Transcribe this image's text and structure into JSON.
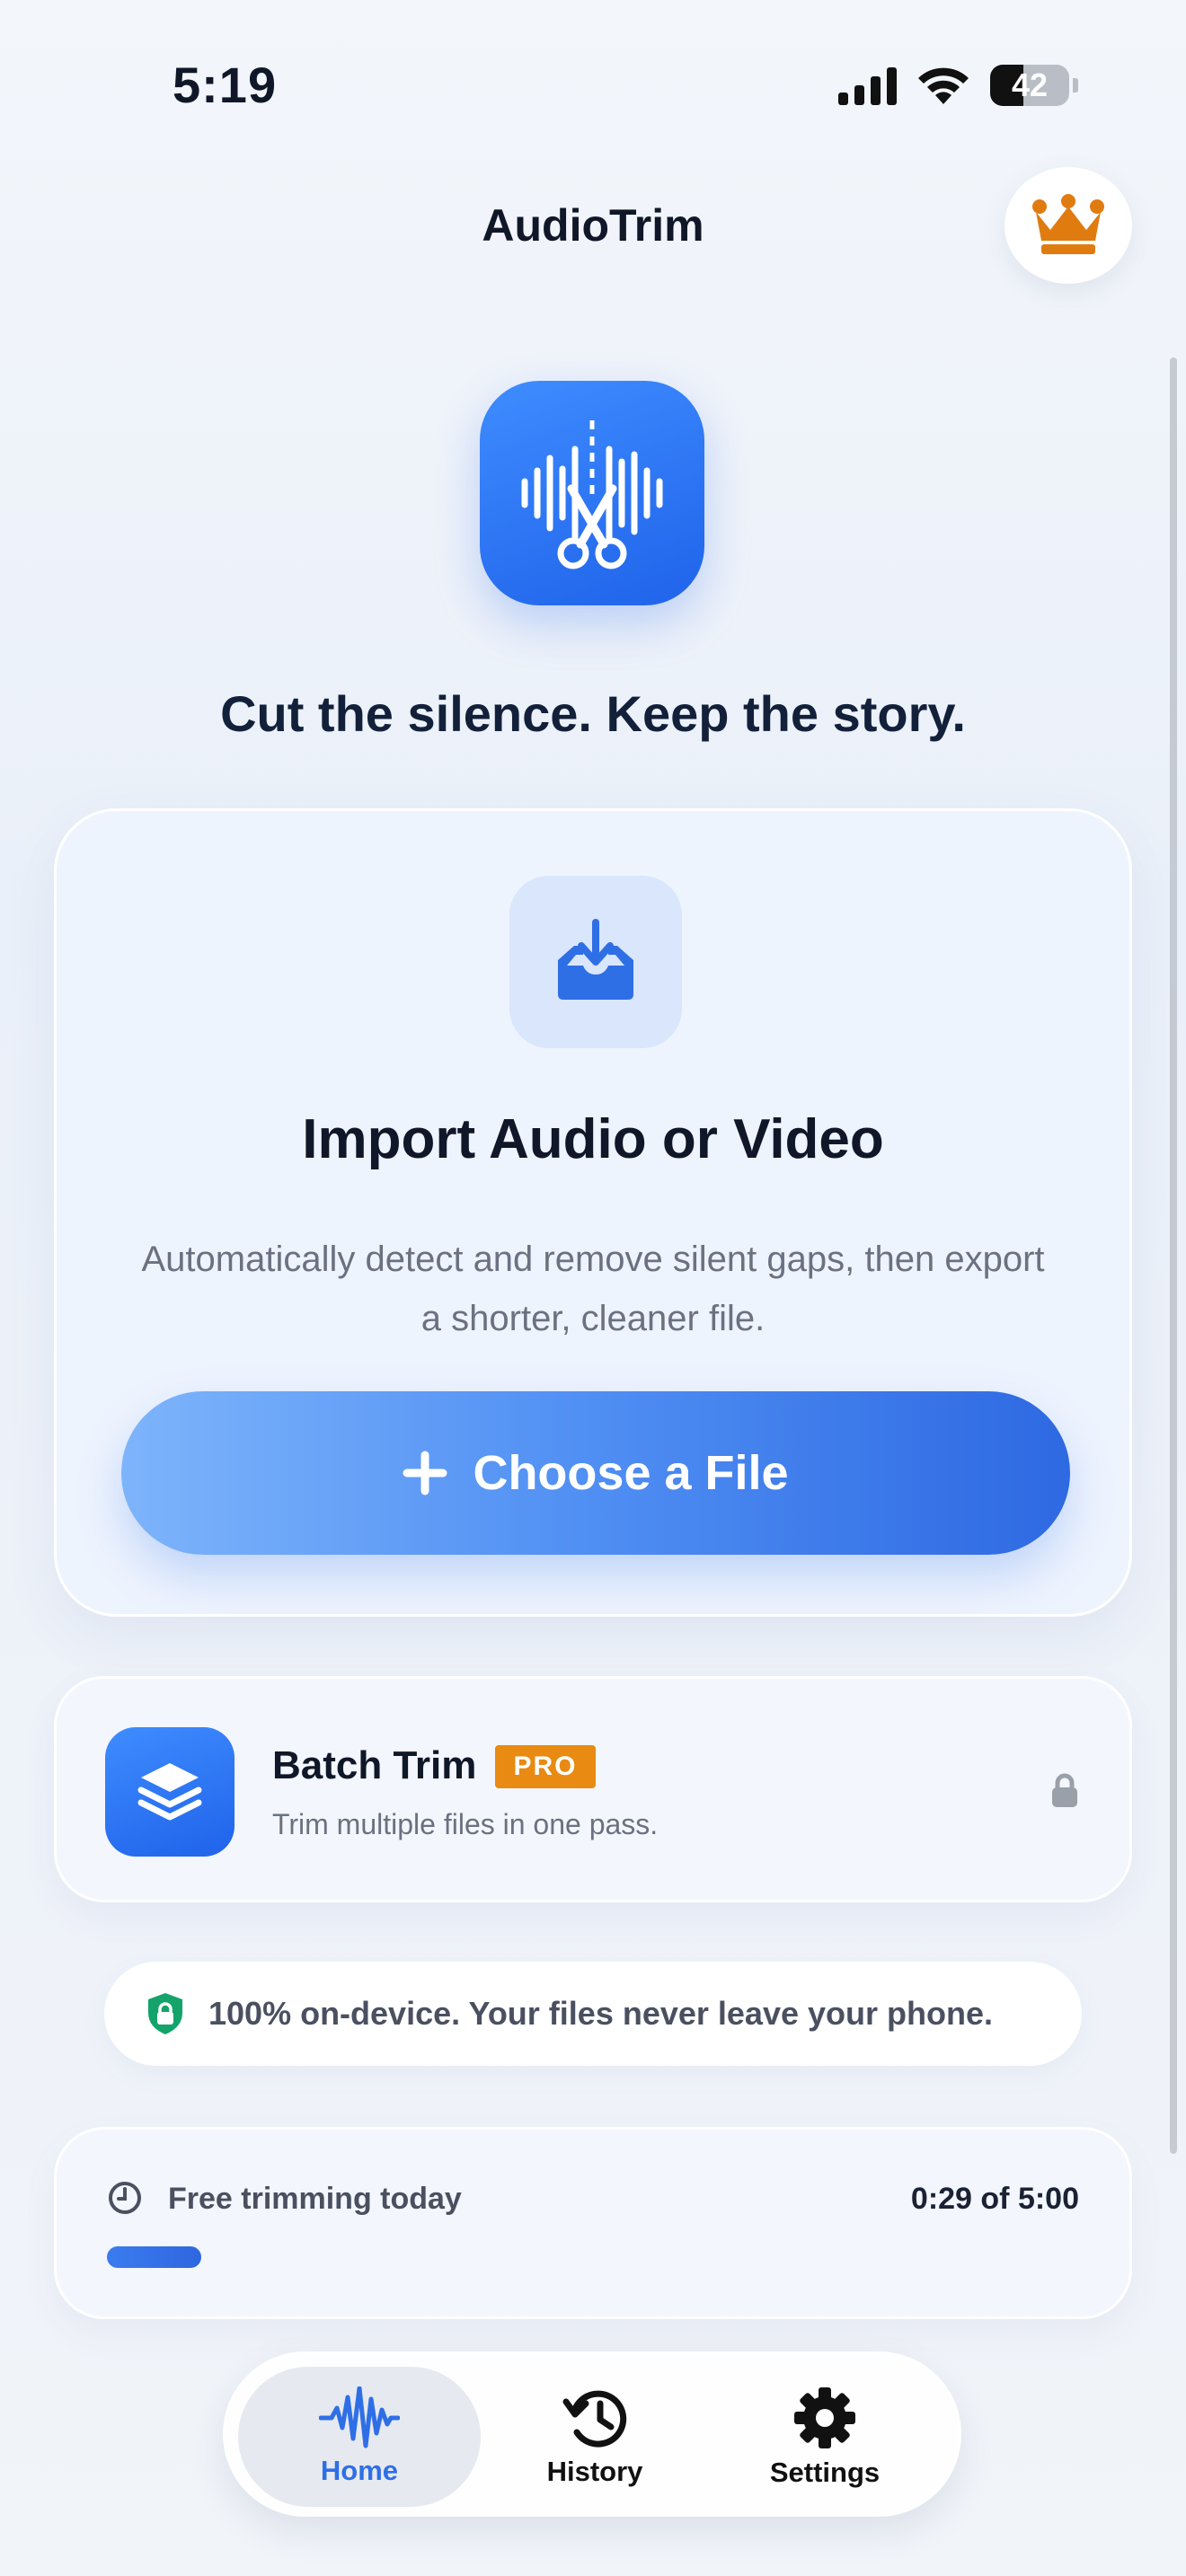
{
  "status_bar": {
    "time": "5:19",
    "battery": "42"
  },
  "header": {
    "title": "AudioTrim",
    "premium_icon": "crown-icon"
  },
  "hero": {
    "app_icon": "waveform-scissors-icon",
    "tagline": "Cut the silence. Keep the story."
  },
  "import_card": {
    "icon": "tray-download-icon",
    "title": "Import Audio or Video",
    "description": "Automatically detect and remove silent gaps, then export a shorter, cleaner file.",
    "button_label": "Choose a File"
  },
  "batch": {
    "icon": "layers-icon",
    "title": "Batch Trim",
    "badge": "PRO",
    "subtitle": "Trim multiple files in one pass."
  },
  "privacy": {
    "icon": "shield-lock-icon",
    "text": "100% on-device. Your files never leave your phone."
  },
  "usage": {
    "label": "Free trimming today",
    "value": "0:29 of 5:00",
    "progress_fraction": 0.097
  },
  "tabs": [
    {
      "label": "Home",
      "icon": "waveform-icon",
      "active": true
    },
    {
      "label": "History",
      "icon": "history-icon",
      "active": false
    },
    {
      "label": "Settings",
      "icon": "gear-icon",
      "active": false
    }
  ],
  "colors": {
    "accent": "#2f6fe6",
    "pro_badge": "#e98a12",
    "crown": "#e07b10",
    "shield": "#14a36b"
  }
}
